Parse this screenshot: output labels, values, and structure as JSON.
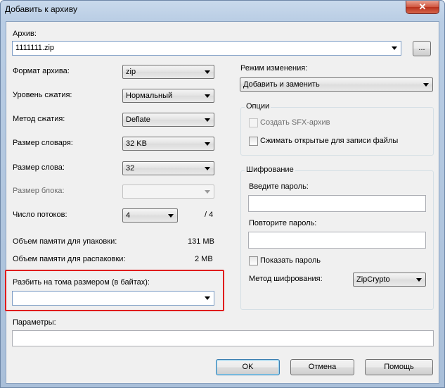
{
  "window": {
    "title": "Добавить к архиву",
    "close_glyph": "✕"
  },
  "archive": {
    "label": "Архив:",
    "value": "1111111.zip",
    "browse": "..."
  },
  "left": {
    "format": {
      "label": "Формат архива:",
      "value": "zip"
    },
    "level": {
      "label": "Уровень сжатия:",
      "value": "Нормальный"
    },
    "method": {
      "label": "Метод сжатия:",
      "value": "Deflate"
    },
    "dict": {
      "label": "Размер словаря:",
      "value": "32 KB"
    },
    "word": {
      "label": "Размер слова:",
      "value": "32"
    },
    "block": {
      "label": "Размер блока:",
      "value": ""
    },
    "threads": {
      "label": "Число потоков:",
      "value": "4",
      "max": "/ 4"
    },
    "mem_pack": {
      "label": "Объем памяти для упаковки:",
      "value": "131 MB"
    },
    "mem_unpack": {
      "label": "Объем памяти для распаковки:",
      "value": "2 MB"
    },
    "split": {
      "label": "Разбить на тома размером (в байтах):",
      "value": ""
    },
    "params": {
      "label": "Параметры:",
      "value": ""
    }
  },
  "right": {
    "update_mode": {
      "label": "Режим изменения:",
      "value": "Добавить и заменить"
    },
    "options": {
      "title": "Опции",
      "sfx": {
        "label": "Создать SFX-архив",
        "checked": false,
        "enabled": false
      },
      "shared": {
        "label": "Сжимать открытые для записи файлы",
        "checked": false
      }
    },
    "encryption": {
      "title": "Шифрование",
      "password_label": "Введите пароль:",
      "repeat_label": "Повторите пароль:",
      "show_label": "Показать пароль",
      "method_label": "Метод шифрования:",
      "method_value": "ZipCrypto"
    }
  },
  "buttons": {
    "ok": "OK",
    "cancel": "Отмена",
    "help": "Помощь"
  },
  "colors": {
    "highlight": "#e01c1c",
    "close": "#c7432a"
  }
}
